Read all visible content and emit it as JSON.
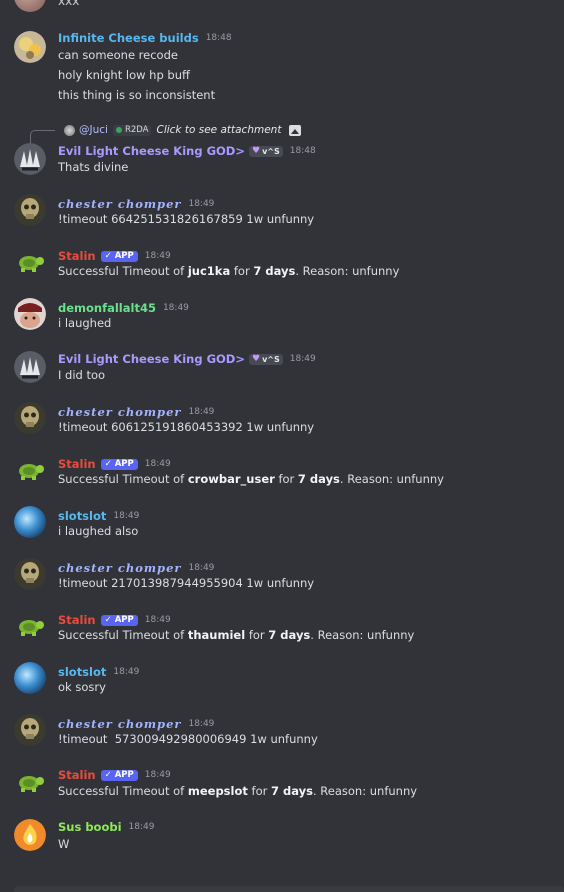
{
  "top_partial_text": "xxx",
  "colors": {
    "background": "#323339",
    "app_badge": "#5865f2",
    "name_cheese_builds": "#56b8ee",
    "name_king": "#a89bff",
    "name_chester": "#a4b4ff",
    "name_stalin": "#e84c3d",
    "name_demon": "#6be08c",
    "name_slotslot": "#56b8ee",
    "name_sus": "#8ee85a"
  },
  "messages": [
    {
      "author": "Infinite Cheese builds",
      "time": "18:48",
      "avatar": "cheese-avatar",
      "lines": [
        "can someone recode",
        "holy knight low hp buff",
        "this thing is so inconsistent"
      ]
    },
    {
      "reply": {
        "mention": "@Juci",
        "role": "R2DA",
        "attachment_text": "Click to see attachment",
        "icon": "image-icon"
      },
      "author": "Evil Light Cheese King GOD>",
      "role_badge": "v^S",
      "time": "18:48",
      "avatar": "king-avatar",
      "lines": [
        "Thats divine"
      ]
    },
    {
      "author": "chester chomper",
      "time": "18:49",
      "avatar": "skull-avatar",
      "lines": [
        "!timeout 664251531826167859 1w unfunny"
      ]
    },
    {
      "author": "Stalin",
      "app_badge": "APP",
      "time": "18:49",
      "avatar": "turtle-avatar",
      "result": {
        "prefix": "Successful Timeout of",
        "user": "juc1ka",
        "for": "for",
        "duration": "7 days",
        "suffix": ". Reason: unfunny"
      }
    },
    {
      "author": "demonfallalt45",
      "time": "18:49",
      "avatar": "demon-avatar",
      "lines": [
        "i laughed"
      ]
    },
    {
      "author": "Evil Light Cheese King GOD>",
      "role_badge": "v^S",
      "time": "18:49",
      "avatar": "king-avatar",
      "lines": [
        "I did too"
      ]
    },
    {
      "author": "chester chomper",
      "time": "18:49",
      "avatar": "skull-avatar",
      "lines": [
        "!timeout 606125191860453392 1w unfunny"
      ]
    },
    {
      "author": "Stalin",
      "app_badge": "APP",
      "time": "18:49",
      "avatar": "turtle-avatar",
      "result": {
        "prefix": "Successful Timeout of",
        "user": "crowbar_user",
        "for": "for",
        "duration": "7 days",
        "suffix": ". Reason: unfunny"
      }
    },
    {
      "author": "slotslot",
      "time": "18:49",
      "avatar": "orb-avatar",
      "lines": [
        "i laughed also"
      ]
    },
    {
      "author": "chester chomper",
      "time": "18:49",
      "avatar": "skull-avatar",
      "lines": [
        "!timeout 217013987944955904 1w unfunny"
      ]
    },
    {
      "author": "Stalin",
      "app_badge": "APP",
      "time": "18:49",
      "avatar": "turtle-avatar",
      "result": {
        "prefix": "Successful Timeout of",
        "user": "thaumiel",
        "for": "for",
        "duration": "7 days",
        "suffix": ". Reason: unfunny"
      }
    },
    {
      "author": "slotslot",
      "time": "18:49",
      "avatar": "orb-avatar",
      "lines": [
        "ok sosry"
      ]
    },
    {
      "author": "chester chomper",
      "time": "18:49",
      "avatar": "skull-avatar",
      "lines": [
        "!timeout  573009492980006949 1w unfunny"
      ]
    },
    {
      "author": "Stalin",
      "app_badge": "APP",
      "time": "18:49",
      "avatar": "turtle-avatar",
      "result": {
        "prefix": "Successful Timeout of",
        "user": "meepslot",
        "for": "for",
        "duration": "7 days",
        "suffix": ". Reason: unfunny"
      }
    },
    {
      "author": "Sus boobi",
      "time": "18:49",
      "avatar": "flame-avatar",
      "lines": [
        "W"
      ]
    }
  ]
}
